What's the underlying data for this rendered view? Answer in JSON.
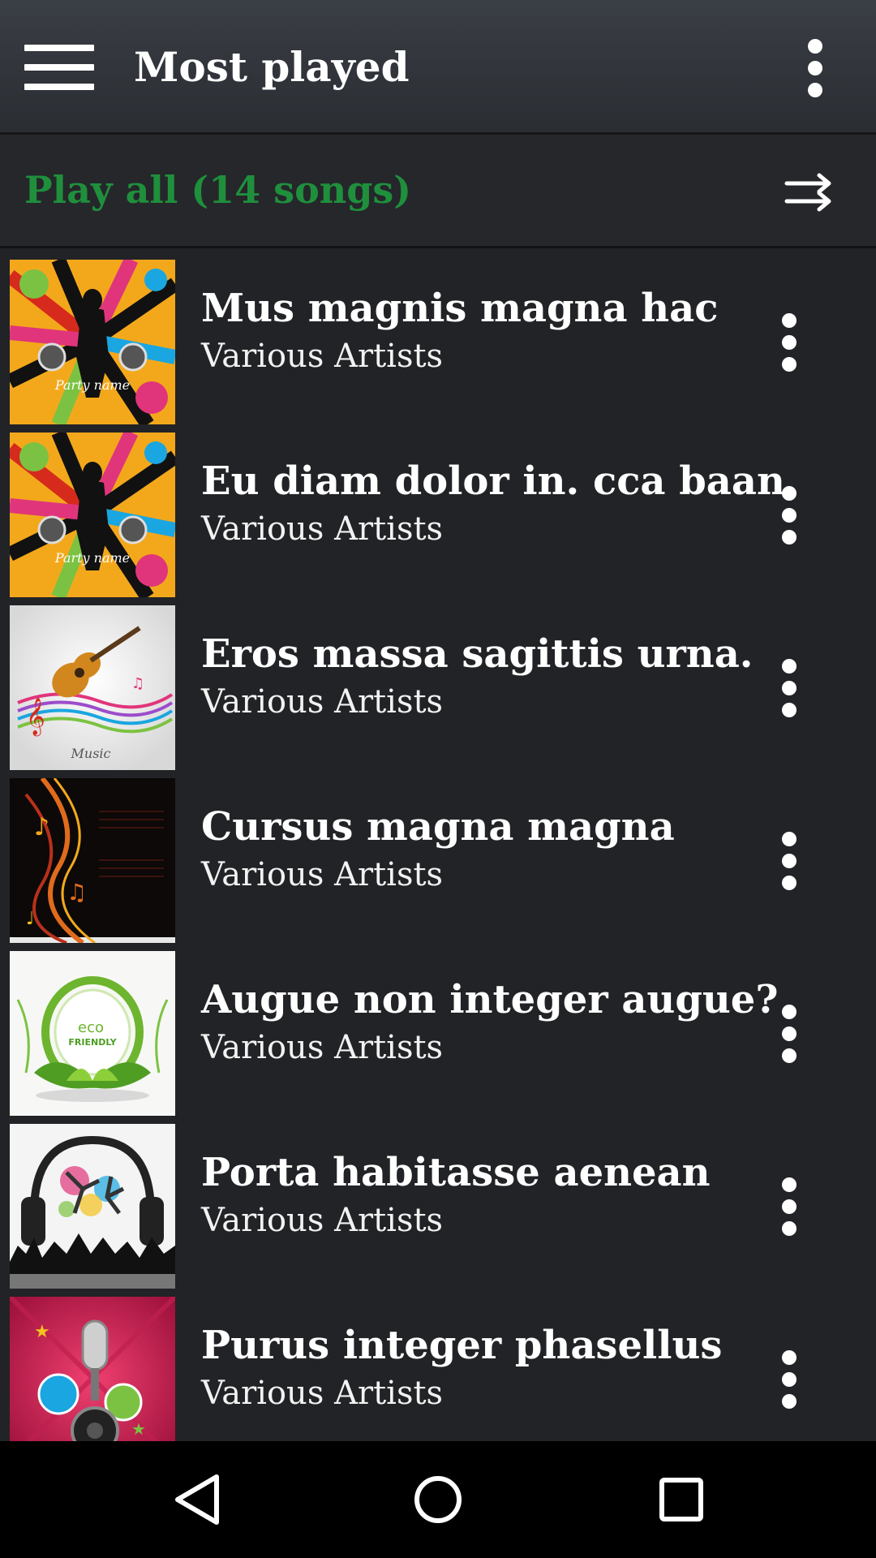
{
  "toolbar": {
    "title": "Most played",
    "menu_icon": "hamburger-menu-icon",
    "overflow_icon": "more-vert-icon"
  },
  "play_all": {
    "label": "Play all (14 songs)",
    "color": "#1f8f3c",
    "icon": "shuffle-icon"
  },
  "songs": [
    {
      "title": "Mus magnis magna hac",
      "artist": "Various Artists",
      "art": "party-name-cover"
    },
    {
      "title": "Eu diam dolor in. cca baan",
      "artist": "Various Artists",
      "art": "party-name-cover"
    },
    {
      "title": "Eros massa sagittis urna.",
      "artist": "Various Artists",
      "art": "guitar-music-cover"
    },
    {
      "title": "Cursus magna magna",
      "artist": "Various Artists",
      "art": "music-notes-cover"
    },
    {
      "title": "Augue non integer augue?",
      "artist": "Various Artists",
      "art": "eco-friendly-cover"
    },
    {
      "title": "Porta habitasse aenean",
      "artist": "Various Artists",
      "art": "headphones-dancers-cover"
    },
    {
      "title": "Purus integer phasellus",
      "artist": "Various Artists",
      "art": "microphone-cover"
    }
  ],
  "art_text": {
    "party": "Party name",
    "music": "Music",
    "eco_line1": "eco",
    "eco_line2": "FRIENDLY"
  },
  "navbar": {
    "back_icon": "back-triangle-icon",
    "home_icon": "home-circle-icon",
    "recents_icon": "recents-square-icon"
  }
}
